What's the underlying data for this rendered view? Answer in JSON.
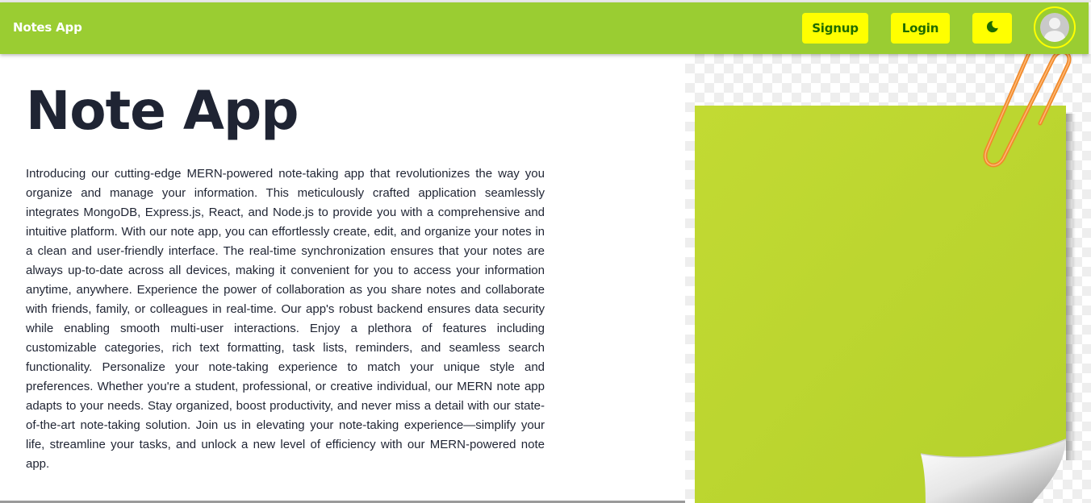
{
  "navbar": {
    "brand": "Notes App",
    "signup_label": "Signup",
    "login_label": "Login",
    "theme_toggle_icon": "moon-icon",
    "avatar_icon": "user-avatar-icon",
    "background_color": "#9acd32",
    "button_color": "#ffff00",
    "button_text_color": "#1f6b00"
  },
  "hero": {
    "title": "Note App",
    "description": "Introducing our cutting-edge MERN-powered note-taking app that revolutionizes the way you organize and manage your information. This meticulously crafted application seamlessly integrates MongoDB, Express.js, React, and Node.js to provide you with a comprehensive and intuitive platform. With our note app, you can effortlessly create, edit, and organize your notes in a clean and user-friendly interface. The real-time synchronization ensures that your notes are always up-to-date across all devices, making it convenient for you to access your information anytime, anywhere. Experience the power of collaboration as you share notes and collaborate with friends, family, or colleagues in real-time. Our app's robust backend ensures data security while enabling smooth multi-user interactions. Enjoy a plethora of features including customizable categories, rich text formatting, task lists, reminders, and seamless search functionality. Personalize your note-taking experience to match your unique style and preferences. Whether you're a student, professional, or creative individual, our MERN note app adapts to your needs. Stay organized, boost productivity, and never miss a detail with our state-of-the-art note-taking solution. Join us in elevating your note-taking experience—simplify your life, streamline your tasks, and unlock a new level of efficiency with our MERN-powered note app."
  },
  "illustration": {
    "icon": "sticky-note-paperclip-illustration",
    "note_color": "#c0d831",
    "clip_color": "#f08a2a"
  }
}
